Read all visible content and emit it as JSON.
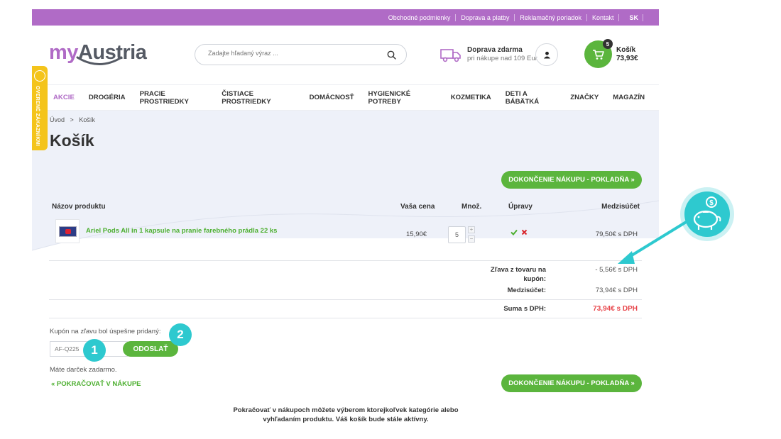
{
  "topbar": {
    "links": [
      "Obchodné podmienky",
      "Doprava a platby",
      "Reklamačný poriadok",
      "Kontakt"
    ],
    "lang": "SK"
  },
  "header": {
    "logo_my": "my",
    "logo_austria": "Austria",
    "search_placeholder": "Zadajte hľadaný výraz ...",
    "delivery_title": "Doprava zdarma",
    "delivery_sub": "pri nákupe nad 109 Eur",
    "cart_count": "5",
    "cart_label": "Košík",
    "cart_total": "73,93€"
  },
  "nav": [
    "AKCIE",
    "DROGÉRIA",
    "PRACIE PROSTRIEDKY",
    "ČISTIACE PROSTRIEDKY",
    "DOMÁCNOSŤ",
    "HYGIENICKÉ POTREBY",
    "KOZMETIKA",
    "DETI A BÁBÄTKÁ",
    "ZNAČKY",
    "MAGAZÍN"
  ],
  "breadcrumb": {
    "home": "Úvod",
    "sep": ">",
    "current": "Košík"
  },
  "page_title": "Košík",
  "verified_badge": "OVERENÉ ZÁKAZNÍKMI",
  "checkout_label": "DOKONČENIE NÁKUPU - POKLADŇA »",
  "table": {
    "headers": {
      "product": "Názov produktu",
      "price": "Vaša cena",
      "qty": "Množ.",
      "edit": "Úpravy",
      "subtotal": "Medzisúčet"
    },
    "row": {
      "name": "Ariel Pods All in 1 kapsule na pranie farebného prádla 22 ks",
      "price": "15,90€",
      "qty": "5",
      "subtotal": "79,50€ s DPH"
    }
  },
  "summary": {
    "discount_label_1": "Zľava z tovaru na",
    "discount_label_2": "kupón:",
    "discount_value": "- 5,56€ s DPH",
    "subtotal_label": "Medzisúčet:",
    "subtotal_value": "73,94€ s DPH",
    "total_label": "Suma s DPH:",
    "total_value": "73,94€ s DPH"
  },
  "coupon": {
    "message": "Kupón na zľavu bol úspešne pridaný:",
    "code": "AF-Q225",
    "submit": "ODOSLAŤ"
  },
  "gift_note": "Máte darček zadarmo.",
  "continue_link": "« POKRAČOVAŤ V NÁKUPE",
  "bottom_note_1": "Pokračovať v nákupoch môžete výberom ktorejkoľvek kategórie alebo",
  "bottom_note_2": "vyhľadaním produktu. Váš košík bude stále aktívny.",
  "annotations": {
    "step1": "1",
    "step2": "2"
  },
  "colors": {
    "purple": "#b06bc6",
    "green": "#5bb53d",
    "teal": "#2ec9cf",
    "red": "#e8474c",
    "yellow": "#f4c41b"
  }
}
